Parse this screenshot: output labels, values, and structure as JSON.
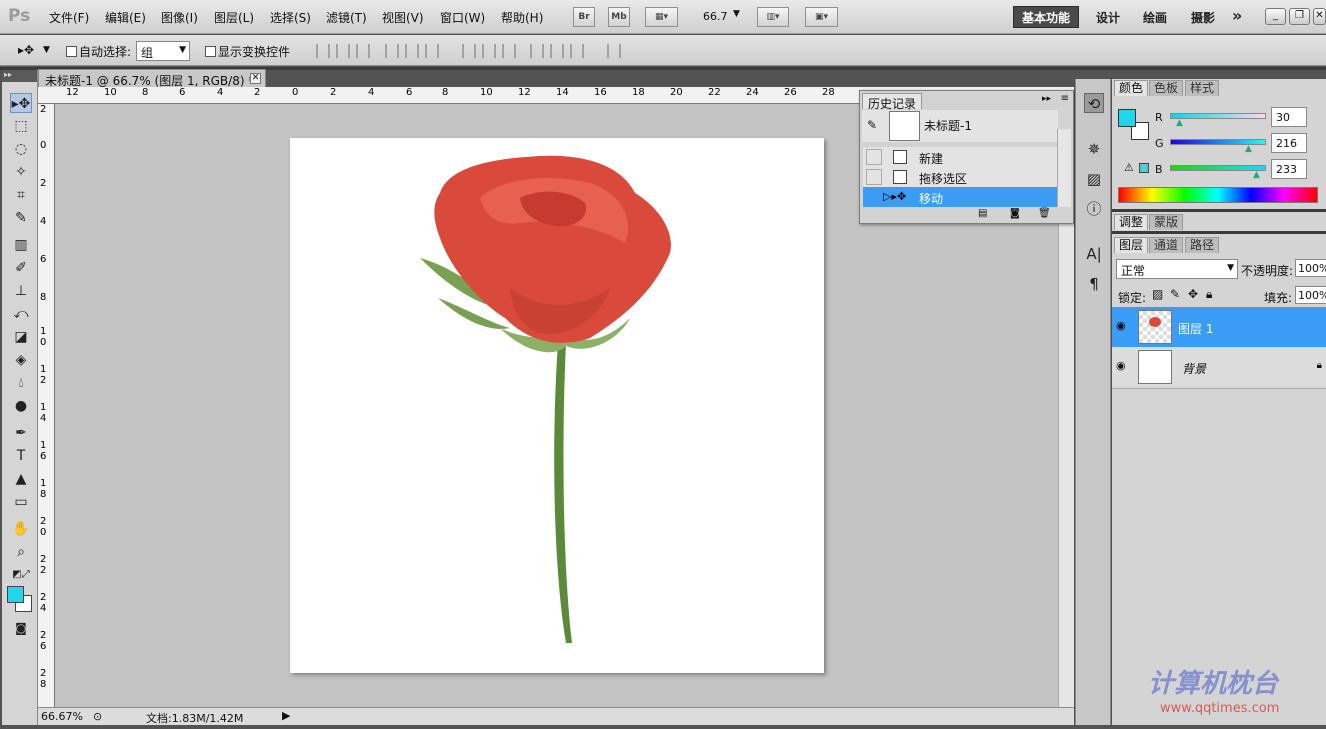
{
  "app": {
    "logo": "Ps",
    "menus": [
      "文件(F)",
      "编辑(E)",
      "图像(I)",
      "图层(L)",
      "选择(S)",
      "滤镜(T)",
      "视图(V)",
      "窗口(W)",
      "帮助(H)"
    ],
    "bridge": "Br",
    "mini": "Mb",
    "zoom": "66.7",
    "workspaces": [
      "基本功能",
      "设计",
      "绘画",
      "摄影"
    ],
    "more": "»",
    "window_controls": [
      "_",
      "❐",
      "✕"
    ]
  },
  "options": {
    "tool_glyph": "▸✥",
    "auto_select": "自动选择:",
    "auto_select_value": "组",
    "show_transform": "显示变换控件"
  },
  "document": {
    "tab_title": "未标题-1 @ 66.7% (图层 1, RGB/8) *",
    "close": "✕",
    "ruler_h": [
      "12",
      "10",
      "8",
      "6",
      "4",
      "2",
      "0",
      "2",
      "4",
      "6",
      "8",
      "10",
      "12",
      "14",
      "16",
      "18",
      "20",
      "22",
      "24",
      "26",
      "28"
    ],
    "ruler_v": [
      "2",
      "0",
      "2",
      "4",
      "6",
      "8",
      "1\n0",
      "1\n2",
      "1\n4",
      "1\n6",
      "1\n8",
      "2\n0",
      "2\n2",
      "2\n4",
      "2\n6",
      "2\n8"
    ],
    "status_zoom": "66.67%",
    "status_doc": "文档:1.83M/1.42M"
  },
  "history": {
    "title": "历史记录",
    "snapshot": "未标题-1",
    "items": [
      "新建",
      "拖移选区",
      "移动"
    ],
    "active_index": 2
  },
  "color_panel": {
    "tabs": [
      "颜色",
      "色板",
      "样式"
    ],
    "channels": [
      {
        "label": "R",
        "value": "30"
      },
      {
        "label": "G",
        "value": "216"
      },
      {
        "label": "B",
        "value": "233"
      }
    ],
    "foreground": "#1ed8e9",
    "background": "#ffffff"
  },
  "adjust_panel": {
    "tabs": [
      "调整",
      "蒙版"
    ]
  },
  "layers_panel": {
    "tabs": [
      "图层",
      "通道",
      "路径"
    ],
    "blend_mode": "正常",
    "opacity_label": "不透明度:",
    "opacity": "100%",
    "lock_label": "锁定:",
    "fill_label": "填充:",
    "fill": "100%",
    "layers": [
      {
        "name": "图层 1",
        "selected": true
      },
      {
        "name": "背景",
        "selected": false
      }
    ]
  },
  "watermark": {
    "text": "计算机枕台",
    "url": "www.qqtimes.com"
  },
  "colors": {
    "accent": "#3a9cf5",
    "swatch": "#1ed8e9"
  }
}
